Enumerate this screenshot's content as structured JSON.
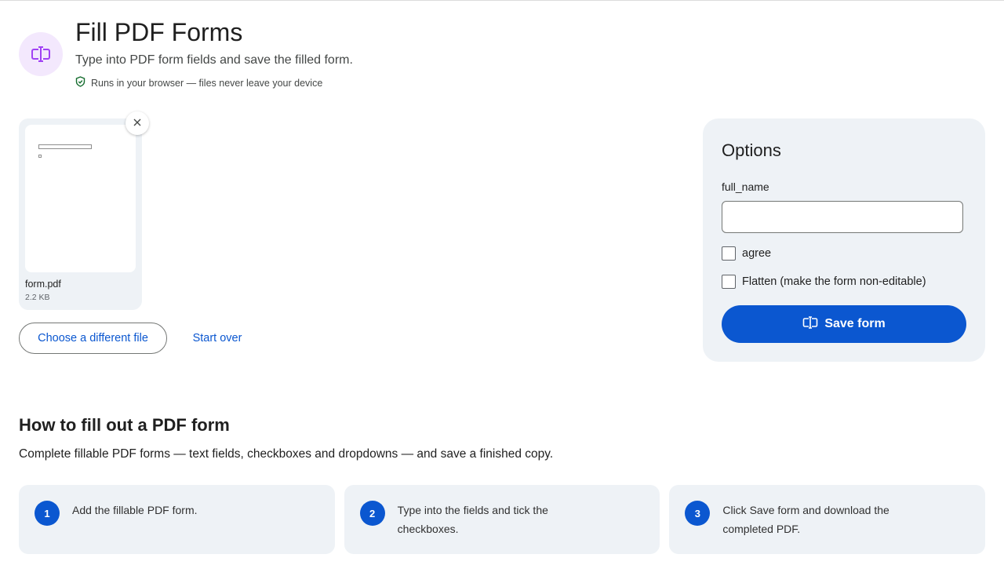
{
  "header": {
    "icon": "text-cursor-icon",
    "title": "Fill PDF Forms",
    "subtitle": "Type into PDF form fields and save the filled form.",
    "privacy_note": "Runs in your browser — files never leave your device",
    "accent_color": "#a142f4"
  },
  "file": {
    "name": "form.pdf",
    "size": "2.2 KB"
  },
  "actions": {
    "choose_label": "Choose a different file",
    "start_over_label": "Start over"
  },
  "options": {
    "title": "Options",
    "field_label": "full_name",
    "field_value": "",
    "agree_label": "agree",
    "agree_checked": false,
    "flatten_label": "Flatten (make the form non-editable)",
    "flatten_checked": false,
    "save_label": "Save form"
  },
  "howto": {
    "title": "How to fill out a PDF form",
    "description": "Complete fillable PDF forms — text fields, checkboxes and dropdowns — and save a finished copy.",
    "steps": [
      {
        "number": "1",
        "text": "Add the fillable PDF form."
      },
      {
        "number": "2",
        "text": "Type into the fields and tick the checkboxes."
      },
      {
        "number": "3",
        "text": "Click Save form and download the completed PDF."
      }
    ]
  },
  "colors": {
    "primary": "#0b57d0",
    "panel_bg": "#eef2f6",
    "icon_bg": "#f3e8fd"
  }
}
